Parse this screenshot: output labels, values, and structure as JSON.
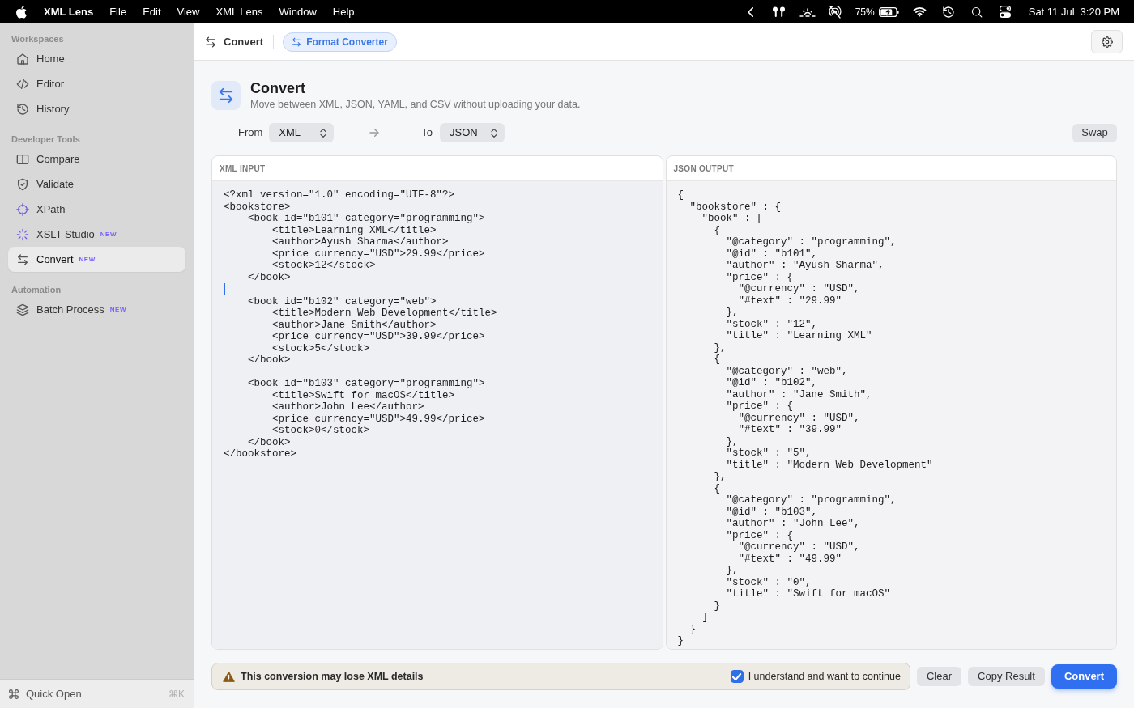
{
  "menu_bar": {
    "app_name": "XML Lens",
    "menus": [
      "File",
      "Edit",
      "View",
      "XML Lens",
      "Window",
      "Help"
    ],
    "battery_percent": "75%",
    "date": "Sat 11 Jul",
    "time": "3:20 PM"
  },
  "sidebar": {
    "sections": [
      {
        "title": "Workspaces",
        "items": [
          {
            "label": "Home",
            "selected": false
          },
          {
            "label": "Editor",
            "selected": false
          },
          {
            "label": "History",
            "selected": false
          }
        ]
      },
      {
        "title": "Developer Tools",
        "items": [
          {
            "label": "Compare",
            "selected": false
          },
          {
            "label": "Validate",
            "selected": false
          },
          {
            "label": "XPath",
            "selected": false
          },
          {
            "label": "XSLT Studio",
            "badge": "NEW",
            "selected": false
          },
          {
            "label": "Convert",
            "badge": "NEW",
            "selected": true
          }
        ]
      },
      {
        "title": "Automation",
        "items": [
          {
            "label": "Batch Process",
            "badge": "NEW",
            "selected": false
          }
        ]
      }
    ],
    "quick_open": {
      "label": "Quick Open",
      "shortcut": "⌘K"
    }
  },
  "toolbar": {
    "title": "Convert",
    "chip": "Format Converter"
  },
  "header": {
    "title": "Convert",
    "subtitle": "Move between XML, JSON, YAML, and CSV without uploading your data."
  },
  "format_row": {
    "from_label": "From",
    "from_value": "XML",
    "to_label": "To",
    "to_value": "JSON",
    "swap": "Swap"
  },
  "input_panel": {
    "label": "XML INPUT",
    "text_before_caret": "<?xml version=\"1.0\" encoding=\"UTF-8\"?>\n<bookstore>\n    <book id=\"b101\" category=\"programming\">\n        <title>Learning XML</title>\n        <author>Ayush Sharma</author>\n        <price currency=\"USD\">29.99</price>\n        <stock>12</stock>\n    </book>\n",
    "text_after_caret": "\n    <book id=\"b102\" category=\"web\">\n        <title>Modern Web Development</title>\n        <author>Jane Smith</author>\n        <price currency=\"USD\">39.99</price>\n        <stock>5</stock>\n    </book>\n\n    <book id=\"b103\" category=\"programming\">\n        <title>Swift for macOS</title>\n        <author>John Lee</author>\n        <price currency=\"USD\">49.99</price>\n        <stock>0</stock>\n    </book>\n</bookstore>"
  },
  "output_panel": {
    "label": "JSON OUTPUT",
    "text": "{\n  \"bookstore\" : {\n    \"book\" : [\n      {\n        \"@category\" : \"programming\",\n        \"@id\" : \"b101\",\n        \"author\" : \"Ayush Sharma\",\n        \"price\" : {\n          \"@currency\" : \"USD\",\n          \"#text\" : \"29.99\"\n        },\n        \"stock\" : \"12\",\n        \"title\" : \"Learning XML\"\n      },\n      {\n        \"@category\" : \"web\",\n        \"@id\" : \"b102\",\n        \"author\" : \"Jane Smith\",\n        \"price\" : {\n          \"@currency\" : \"USD\",\n          \"#text\" : \"39.99\"\n        },\n        \"stock\" : \"5\",\n        \"title\" : \"Modern Web Development\"\n      },\n      {\n        \"@category\" : \"programming\",\n        \"@id\" : \"b103\",\n        \"author\" : \"John Lee\",\n        \"price\" : {\n          \"@currency\" : \"USD\",\n          \"#text\" : \"49.99\"\n        },\n        \"stock\" : \"0\",\n        \"title\" : \"Swift for macOS\"\n      }\n    ]\n  }\n}"
  },
  "warning": {
    "message": "This conversion may lose XML details",
    "confirm": {
      "label": "I understand and want to continue",
      "checked": true
    }
  },
  "actions": [
    {
      "label": "Clear",
      "kind": "secondary"
    },
    {
      "label": "Copy Result",
      "kind": "secondary"
    },
    {
      "label": "Convert",
      "kind": "primary"
    }
  ]
}
